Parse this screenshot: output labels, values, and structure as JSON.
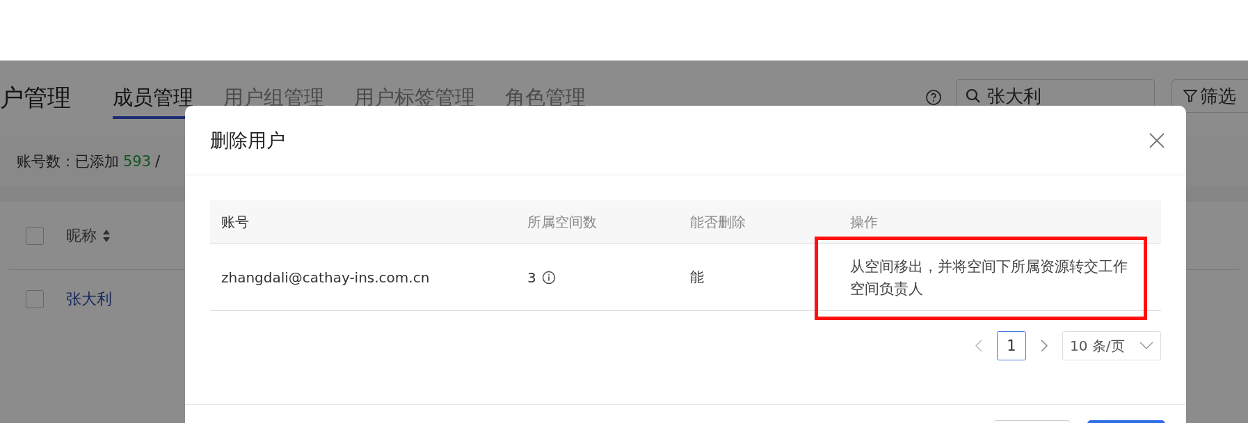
{
  "page": {
    "title": "户管理",
    "tabs": [
      {
        "label": "成员管理",
        "selected": true
      },
      {
        "label": "用户组管理",
        "selected": false
      },
      {
        "label": "用户标签管理",
        "selected": false
      },
      {
        "label": "角色管理",
        "selected": false
      }
    ],
    "search": {
      "value": "张大利"
    },
    "filter_button": "筛选",
    "account_count": {
      "label": "账号数：已添加",
      "added": "593",
      "separator": "/"
    },
    "table": {
      "header_checked": false,
      "columns": [
        {
          "label": "昵称"
        }
      ],
      "rows": [
        {
          "nickname": "张大利",
          "checked": false
        }
      ]
    }
  },
  "dialog": {
    "title": "删除用户",
    "table": {
      "columns": [
        "账号",
        "所属空间数",
        "能否删除",
        "操作"
      ],
      "rows": [
        {
          "account": "zhangdali@cathay-ins.com.cn",
          "space_count": "3",
          "deletable": "能",
          "action": "从空间移出，并将空间下所属资源转交工作空间负责人"
        }
      ]
    },
    "pagination": {
      "pages": [
        {
          "label": "1",
          "selected": true
        }
      ],
      "page_size": "10 条/页"
    }
  }
}
